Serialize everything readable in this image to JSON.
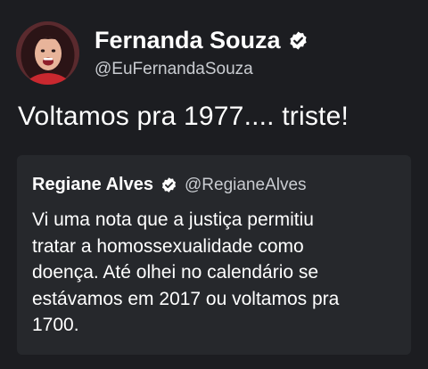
{
  "tweet": {
    "author": {
      "display_name": "Fernanda Souza",
      "handle": "@EuFernandaSouza",
      "avatar_icon": "profile-photo",
      "verified_icon": "verified-badge-icon"
    },
    "text": "Voltamos pra 1977.... triste!",
    "quoted_tweet": {
      "author": {
        "display_name": "Regiane Alves",
        "handle": "@RegianeAlves",
        "verified_icon": "verified-badge-icon"
      },
      "text_lines": [
        "Vi uma nota que a justiça permitiu",
        "tratar a homossexualidade como",
        "doença. Até olhei no calendário se",
        "estávamos em 2017 ou voltamos pra",
        "1700."
      ]
    }
  },
  "colors": {
    "background": "#1c1d21",
    "quote_background": "#26282c",
    "primary_text": "#ffffff",
    "secondary_text": "#c9ccd1"
  }
}
